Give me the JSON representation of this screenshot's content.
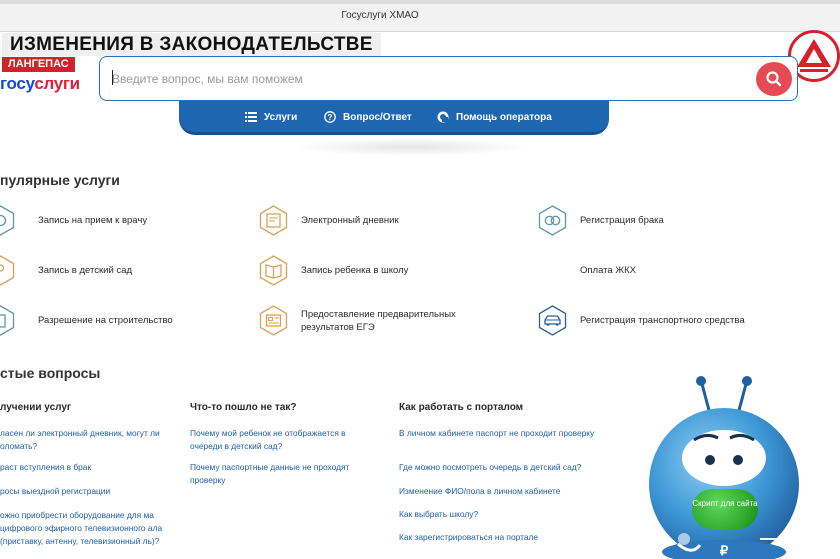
{
  "browser": {
    "tab_title": "Госуслуги ХМАО"
  },
  "overlay": {
    "headline": "ИЗМЕНЕНИЯ В ЗАКОНОДАТЕЛЬСТВЕ",
    "city": "ЛАНГЕПАС"
  },
  "brand": {
    "part1": "госу",
    "part2": "слуги"
  },
  "search": {
    "placeholder": "Введите вопрос, мы вам поможем",
    "value": ""
  },
  "nav": {
    "items": [
      {
        "label": "Услуги",
        "icon": "list-icon"
      },
      {
        "label": "Вопрос/Ответ",
        "icon": "question-icon"
      },
      {
        "label": "Помощь оператора",
        "icon": "operator-icon"
      }
    ]
  },
  "popular": {
    "title": "пулярные услуги",
    "items": [
      {
        "label": "Запись на прием к врачу",
        "icon": "doctor-icon"
      },
      {
        "label": "Электронный дневник",
        "icon": "diary-icon"
      },
      {
        "label": "Регистрация брака",
        "icon": "rings-icon"
      },
      {
        "label": "Запись в детский сад",
        "icon": "kindergarten-icon"
      },
      {
        "label": "Запись ребенка в школу",
        "icon": "book-icon"
      },
      {
        "label": "Оплата ЖКХ",
        "icon": ""
      },
      {
        "label": "Разрешение на строительство",
        "icon": "building-icon"
      },
      {
        "label": "Предоставление предварительных результатов ЕГЭ",
        "icon": "exam-icon"
      },
      {
        "label": "Регистрация транспортного средства",
        "icon": "car-icon"
      }
    ]
  },
  "faq": {
    "title": "стые вопросы",
    "columns": [
      {
        "title": "лучении услуг",
        "links": [
          "ласен ли электронный дневник, могут ли оломать?",
          "раст вступления в брак",
          "росы выездной регистрации",
          "ожно приобрести оборудование для ма цифрового эфирного телевизионного ала (приставку, антенну, телевизионный ль)?"
        ]
      },
      {
        "title": "Что-то пошло не так?",
        "links": [
          "Почему мой ребенок не отображается в очереди в детский сад?",
          "Почему паспортные данные не проходят проверку"
        ]
      },
      {
        "title": "Как работать с порталом",
        "links": [
          "В личном кабинете паспорт не проходит проверку",
          "Где можно посмотреть очередь в детский сад?",
          "Изменение ФИО/пола в личном кабинете",
          "Как выбрать школу?",
          "Как зарегистрироваться на портале"
        ]
      }
    ]
  },
  "mascot": {
    "button": "Скрипт для сайта"
  },
  "colors": {
    "accent": "#1f66b1",
    "brand_red": "#e3203b",
    "brand_blue": "#0d4cd3",
    "link": "#1f5fa6",
    "icon_orange": "#d9a15a",
    "icon_teal": "#5b9aa6"
  }
}
